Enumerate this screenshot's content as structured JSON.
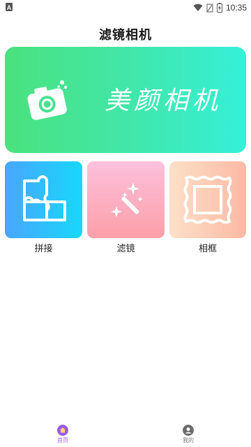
{
  "status_bar": {
    "time": "10:35",
    "icons": [
      "wifi-icon",
      "no-sim-icon",
      "battery-icon"
    ]
  },
  "app_title": "滤镜相机",
  "banner": {
    "text": "美颜相机",
    "icon": "camera-icon",
    "gradient": [
      "#4ae27e",
      "#35f0d9"
    ]
  },
  "features": [
    {
      "label": "拼接",
      "icon": "puzzle-icon",
      "colors": [
        "#49a6fb",
        "#17d7fb"
      ]
    },
    {
      "label": "滤镜",
      "icon": "magic-wand-icon",
      "colors": [
        "#fcc1dc",
        "#fc9fa9"
      ]
    },
    {
      "label": "相框",
      "icon": "photo-frame-icon",
      "colors": [
        "#fde0c8",
        "#fbb9a4"
      ]
    }
  ],
  "bottom_nav": [
    {
      "label": "首页",
      "icon": "home-icon",
      "active": true,
      "color": "#a65cf0"
    },
    {
      "label": "我的",
      "icon": "profile-icon",
      "active": false,
      "color": "#777777"
    }
  ]
}
